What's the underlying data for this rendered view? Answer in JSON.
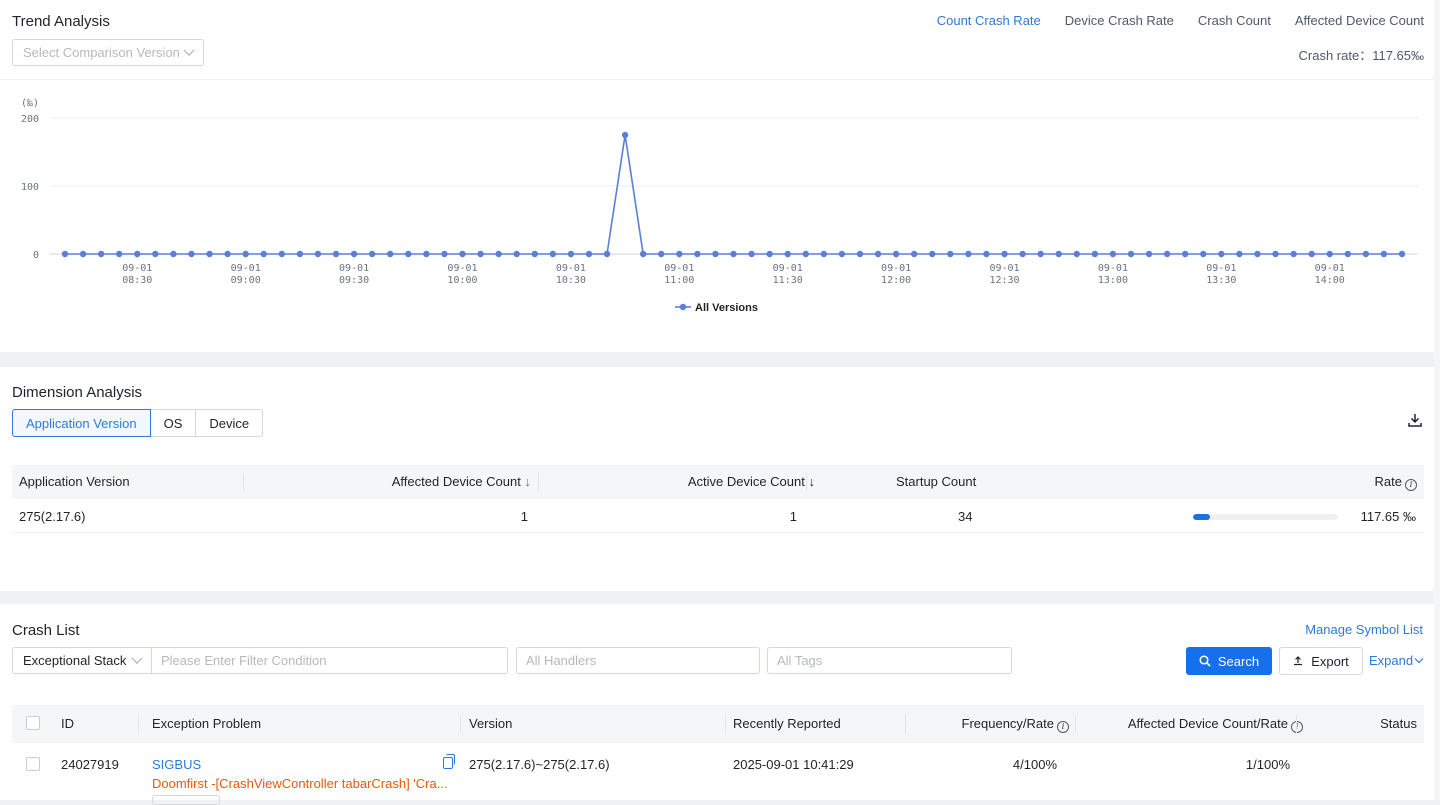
{
  "trend": {
    "title": "Trend Analysis",
    "select_placeholder": "Select Comparison Version",
    "metric_tabs": [
      "Count Crash Rate",
      "Device Crash Rate",
      "Crash Count",
      "Affected Device Count"
    ],
    "active_tab": 0,
    "crash_rate_label": "Crash rate：",
    "crash_rate_value": "117.65‰"
  },
  "chart_data": {
    "type": "line",
    "ylabel": "(‰)",
    "ylim": [
      0,
      200
    ],
    "yticks": [
      0,
      100,
      200
    ],
    "xlabel": "",
    "x_ticks": [
      [
        "09-01",
        "08:30"
      ],
      [
        "09-01",
        "09:00"
      ],
      [
        "09-01",
        "09:30"
      ],
      [
        "09-01",
        "10:00"
      ],
      [
        "09-01",
        "10:30"
      ],
      [
        "09-01",
        "11:00"
      ],
      [
        "09-01",
        "11:30"
      ],
      [
        "09-01",
        "12:00"
      ],
      [
        "09-01",
        "12:30"
      ],
      [
        "09-01",
        "13:00"
      ],
      [
        "09-01",
        "13:30"
      ],
      [
        "09-01",
        "14:00"
      ]
    ],
    "x_start": "08:10",
    "x_step_minutes": 5,
    "series": [
      {
        "name": "All Versions",
        "color": "#5b7fd6",
        "values": [
          0,
          0,
          0,
          0,
          0,
          0,
          0,
          0,
          0,
          0,
          0,
          0,
          0,
          0,
          0,
          0,
          0,
          0,
          0,
          0,
          0,
          0,
          0,
          0,
          0,
          0,
          0,
          0,
          0,
          0,
          0,
          175,
          0,
          0,
          0,
          0,
          0,
          0,
          0,
          0,
          0,
          0,
          0,
          0,
          0,
          0,
          0,
          0,
          0,
          0,
          0,
          0,
          0,
          0,
          0,
          0,
          0,
          0,
          0,
          0,
          0,
          0,
          0,
          0,
          0,
          0,
          0,
          0,
          0,
          0,
          0,
          0,
          0,
          0,
          0
        ]
      }
    ],
    "legend_position": "bottom-center",
    "grid": true
  },
  "dimension": {
    "title": "Dimension Analysis",
    "tabs": [
      "Application Version",
      "OS",
      "Device"
    ],
    "active_tab": 0,
    "columns": [
      "Application Version",
      "Affected Device Count",
      "Active Device Count",
      "Startup Count",
      "Rate"
    ],
    "sort_arrow": "↓",
    "rows": [
      {
        "version": "275(2.17.6)",
        "affected": "1",
        "active": "1",
        "startup": "34",
        "rate": "117.65 ‰",
        "rate_fraction": 0.118
      }
    ]
  },
  "crash_list": {
    "title": "Crash List",
    "manage_link": "Manage Symbol List",
    "filter_type": "Exceptional Stack",
    "filter_placeholder": "Please Enter Filter Condition",
    "handlers_placeholder": "All Handlers",
    "tags_placeholder": "All Tags",
    "search_label": "Search",
    "export_label": "Export",
    "expand_label": "Expand",
    "columns": [
      "ID",
      "Exception Problem",
      "Version",
      "Recently Reported",
      "Frequency/Rate",
      "Affected Device Count/Rate",
      "Status"
    ],
    "rows": [
      {
        "id": "24027919",
        "type": "SIGBUS",
        "description": "Doomfirst -[CrashViewController  tabarCrash] 'Cra...",
        "version": "275(2.17.6)~275(2.17.6)",
        "reported": "2025-09-01 10:41:29",
        "frequency": "4/100%",
        "affected": "1/100%",
        "status": ""
      }
    ]
  }
}
